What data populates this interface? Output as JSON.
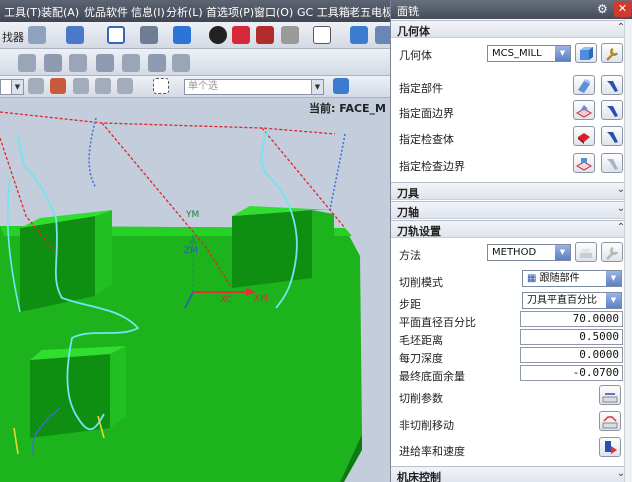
{
  "menubar": {
    "items": [
      "工具(T)",
      "装配(A)",
      "优品软件",
      "信息(I)",
      "分析(L)",
      "首选项(P)",
      "窗口(O)",
      "GC 工具箱",
      "老五电极"
    ]
  },
  "toolbar": {
    "finder_label": "找器",
    "filter_combo_placeholder": "单个选",
    "viewport_title": "当前: FACE_M"
  },
  "viewport": {
    "axis_labels": {
      "ym": "YM",
      "zm": "ZM",
      "xc": "XC",
      "xm": "XM"
    }
  },
  "dialog": {
    "title": "面铣",
    "sections": {
      "geometry": "几何体",
      "tool": "刀具",
      "axis": "刀轴",
      "path_settings": "刀轨设置",
      "machine_control": "机床控制"
    },
    "geometry": {
      "geometry_label": "几何体",
      "geometry_value": "MCS_MILL",
      "specify_part": "指定部件",
      "specify_face_boundary": "指定面边界",
      "specify_check_body": "指定检查体",
      "specify_check_boundary": "指定检查边界"
    },
    "path": {
      "method_label": "方法",
      "method_value": "METHOD",
      "cut_mode_label": "切削模式",
      "cut_mode_value": "跟随部件",
      "stepover_label": "步距",
      "stepover_value": "刀具平直百分比",
      "face_dia_pct_label": "平面直径百分比",
      "face_dia_pct_value": "70.0000",
      "blank_dist_label": "毛坯距离",
      "blank_dist_value": "0.5000",
      "depth_per_cut_label": "每刀深度",
      "depth_per_cut_value": "0.0000",
      "final_floor_stock_label": "最终底面余量",
      "final_floor_stock_value": "-0.0700",
      "cut_params_label": "切削参数",
      "non_cut_moves_label": "非切削移动",
      "feeds_speeds_label": "进给率和速度"
    }
  }
}
